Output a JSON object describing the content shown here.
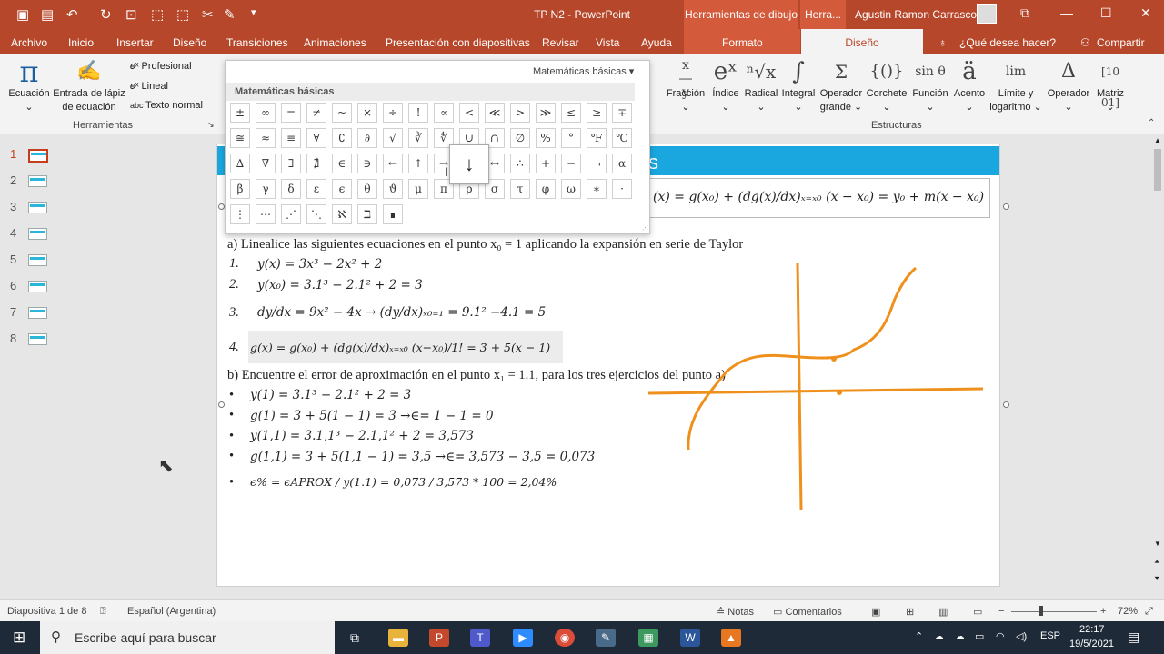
{
  "window": {
    "title": "TP N2  -  PowerPoint",
    "context_tools": "Herramientas de dibujo",
    "context_tools2": "Herra...",
    "user": "Agustin Ramon Carrasco"
  },
  "tabs": {
    "archivo": "Archivo",
    "inicio": "Inicio",
    "insertar": "Insertar",
    "diseno": "Diseño",
    "transiciones": "Transiciones",
    "animaciones": "Animaciones",
    "presentacion": "Presentación con diapositivas",
    "revisar": "Revisar",
    "vista": "Vista",
    "ayuda": "Ayuda",
    "formato": "Formato",
    "diseno_active": "Diseño",
    "tell_me": "¿Qué desea hacer?",
    "share": "Compartir"
  },
  "ribbon": {
    "ecuacion": "Ecuación",
    "entrada1": "Entrada de lápiz",
    "entrada2": "de ecuación",
    "profesional": "Profesional",
    "lineal": "Lineal",
    "texto_normal": "Texto normal",
    "herramientas": "Herramientas",
    "fraccion": "Fracción",
    "indice": "Índice",
    "radical": "Radical",
    "integral": "Integral",
    "operador_grande1": "Operador",
    "operador_grande2": "grande",
    "corchete": "Corchete",
    "funcion": "Función",
    "acento": "Acento",
    "limite1": "Límite y",
    "limite2": "logaritmo",
    "operador": "Operador",
    "matriz": "Matriz",
    "estructuras": "Estructuras",
    "icons": {
      "frac": "x/y",
      "indice": "eˣ",
      "radical": "ⁿ√x",
      "integral": "∫",
      "sum": "Σ",
      "bracket": "{()}",
      "func": "sin θ",
      "accent": "ä",
      "lim": "lim",
      "op": "Δ",
      "matrix": "[10 01]"
    }
  },
  "gallery": {
    "dropdown": "Matemáticas básicas ▾",
    "section": "Matemáticas básicas",
    "tooltip_symbol": "↓",
    "rows": [
      [
        "±",
        "∞",
        "=",
        "≠",
        "~",
        "×",
        "÷",
        "!",
        "∝",
        "<",
        "≪",
        ">",
        "≫",
        "≤",
        "≥",
        "∓"
      ],
      [
        "≅",
        "≈",
        "≡",
        "∀",
        "∁",
        "∂",
        "√",
        "∛",
        "∜",
        "∪",
        "∩",
        "∅",
        "%",
        "°",
        "℉",
        "℃"
      ],
      [
        "∆",
        "∇",
        "∃",
        "∄",
        "∈",
        "∋",
        "←",
        "↑",
        "→",
        "↓",
        "↔",
        "∴",
        "+",
        "−",
        "¬",
        "α"
      ],
      [
        "β",
        "γ",
        "δ",
        "ε",
        "ϵ",
        "θ",
        "ϑ",
        "μ",
        "π",
        "ρ",
        "σ",
        "τ",
        "φ",
        "ω",
        "∗",
        "·"
      ],
      [
        "⋮",
        "⋯",
        "⋰",
        "⋱",
        "ℵ",
        "ℶ",
        "∎"
      ]
    ]
  },
  "slides": {
    "numbers": [
      "1",
      "2",
      "3",
      "4",
      "5",
      "6",
      "7",
      "8"
    ]
  },
  "slide": {
    "band_text": "s",
    "eq_header": "(x) = g(x₀) + (dg(x)/dx)ₓ₌ₓ₀ (x − x₀) = y₀ + m(x − x₀)",
    "a_intro": "a) Linealice las siguientes ecuaciones en el punto x₀ = 1 aplicando la expansión en serie de Taylor",
    "l1n": "1.",
    "l1": "y(x) = 3x³ − 2x² + 2",
    "l2n": "2.",
    "l2": "y(x₀) = 3.1³ − 2.1² + 2 = 3",
    "l3n": "3.",
    "l3": "dy/dx = 9x² − 4x → (dy/dx)ₓ₀₌₁ = 9.1² −4.1 = 5",
    "l4n": "4.",
    "l4": "g(x) = g(x₀) + (dg(x)/dx)ₓ₌ₓ₀ (x−x₀)/1! = 3 + 5(x − 1)",
    "b_intro": "b) Encuentre el error de aproximación en el punto x₁ = 1.1, para los tres ejercicios del punto a)",
    "b1": "y(1) = 3.1³ − 2.1² + 2 = 3",
    "b2": "g(1) = 3 + 5(1 − 1) = 3  →∈= 1 − 1 = 0",
    "b3": "y(1,1) = 3.1,1³ − 2.1,1² + 2 = 3,573",
    "b4": "g(1,1) = 3 + 5(1,1 − 1) = 3,5  →∈= 3,573 − 3,5 = 0,073",
    "b5": "ϵ% = ϵAPROX / y(1.1) = 0,073 / 3,573 * 100 = 2,04%",
    "bullet": "•"
  },
  "status": {
    "slide_info": "Diapositiva 1 de 8",
    "language": "Español (Argentina)",
    "notas": "Notas",
    "comentarios": "Comentarios",
    "zoom": "72%"
  },
  "taskbar": {
    "search_placeholder": "Escribe aquí para buscar",
    "lang": "ESP",
    "time": "22:17",
    "date": "19/5/2021"
  }
}
